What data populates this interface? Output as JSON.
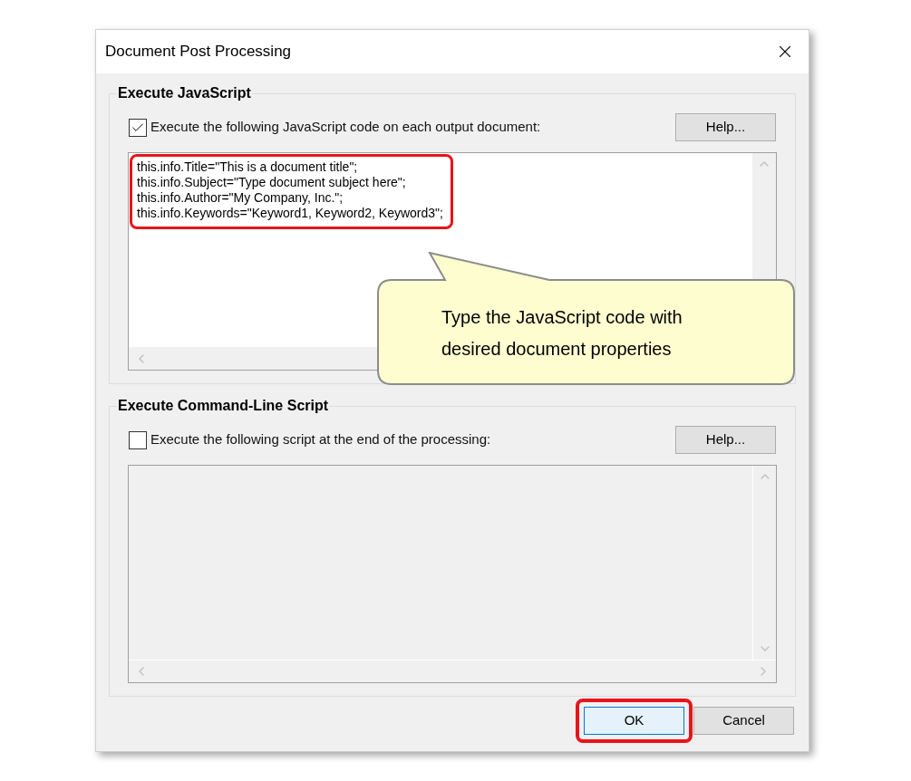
{
  "window": {
    "title": "Document Post Processing"
  },
  "sections": [
    {
      "title": "Execute JavaScript",
      "checkbox": {
        "label": "Execute the following JavaScript code on each output document:",
        "checked": true
      },
      "help_button": "Help...",
      "editor": {
        "disabled": false,
        "highlighted": true,
        "lines": [
          "this.info.Title=\"This is a document title\";",
          "this.info.Subject=\"Type document subject here\";",
          "this.info.Author=\"My Company, Inc.\";",
          "this.info.Keywords=\"Keyword1, Keyword2, Keyword3\";"
        ]
      }
    },
    {
      "title": "Execute Command-Line Script",
      "checkbox": {
        "label": "Execute the following script at the end of the processing:",
        "checked": false
      },
      "help_button": "Help...",
      "editor": {
        "disabled": true
      }
    }
  ],
  "callout": {
    "text": "Type the JavaScript code with desired document properties"
  },
  "buttons": [
    {
      "label": "OK",
      "focused": true,
      "highlighted": true
    },
    {
      "label": "Cancel",
      "focused": false,
      "highlighted": false
    }
  ]
}
